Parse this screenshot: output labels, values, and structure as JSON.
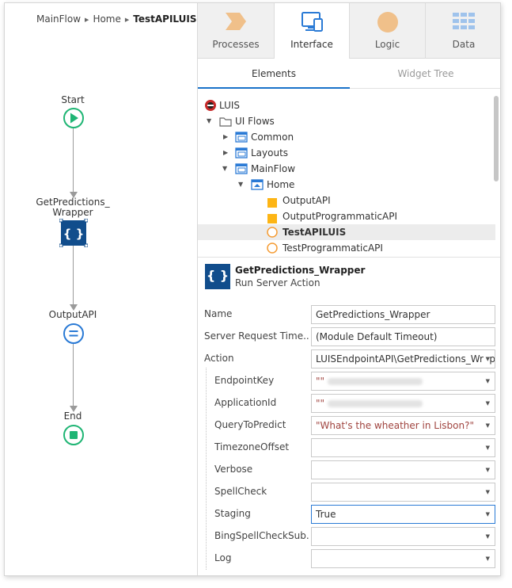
{
  "breadcrumb": {
    "flow": "MainFlow",
    "screen": "Home",
    "current": "TestAPILUIS"
  },
  "flow_nodes": {
    "start": "Start",
    "action": "GetPredictions_\nWrapper",
    "action_line1": "GetPredictions_",
    "action_line2": "Wrapper",
    "output": "OutputAPI",
    "end": "End"
  },
  "tabs": [
    {
      "label": "Processes",
      "icon": "processes-icon"
    },
    {
      "label": "Interface",
      "icon": "interface-icon",
      "active": true
    },
    {
      "label": "Logic",
      "icon": "logic-icon"
    },
    {
      "label": "Data",
      "icon": "data-icon"
    }
  ],
  "subtabs": {
    "elements": "Elements",
    "widget_tree": "Widget Tree"
  },
  "tree": {
    "root": "LUIS",
    "ui_flows": "UI Flows",
    "common": "Common",
    "layouts": "Layouts",
    "mainflow": "MainFlow",
    "home": "Home",
    "items": [
      "OutputAPI",
      "OutputProgrammaticAPI",
      "TestAPILUIS",
      "TestProgrammaticAPI"
    ]
  },
  "selected": {
    "icon_text": "{ }",
    "title": "GetPredictions_Wrapper",
    "subtitle": "Run Server Action"
  },
  "properties": {
    "name_label": "Name",
    "name_value": "GetPredictions_Wrapper",
    "timeout_label": "Server Request Time...",
    "timeout_value": "(Module Default Timeout)",
    "action_label": "Action",
    "action_value": "LUISEndpointAPI\\GetPredictions_Wrapper",
    "params": [
      {
        "label": "EndpointKey",
        "value": "\"\"",
        "blurred": true
      },
      {
        "label": "ApplicationId",
        "value": "\"\"",
        "blurred": true
      },
      {
        "label": "QueryToPredict",
        "value": "\"What's the wheather in Lisbon?\""
      },
      {
        "label": "TimezoneOffset",
        "value": ""
      },
      {
        "label": "Verbose",
        "value": ""
      },
      {
        "label": "SpellCheck",
        "value": ""
      },
      {
        "label": "Staging",
        "value": "True"
      },
      {
        "label": "BingSpellCheckSub...",
        "value": ""
      },
      {
        "label": "Log",
        "value": ""
      }
    ]
  },
  "colors": {
    "accent_blue": "#1a73c9",
    "start_green": "#1fb574",
    "action_blue": "#114d8c",
    "output_blue": "#2a7ad5",
    "logic_orange": "#f0c08a",
    "screen_yellow": "#fdb515",
    "selected_orange": "#f59c34"
  }
}
